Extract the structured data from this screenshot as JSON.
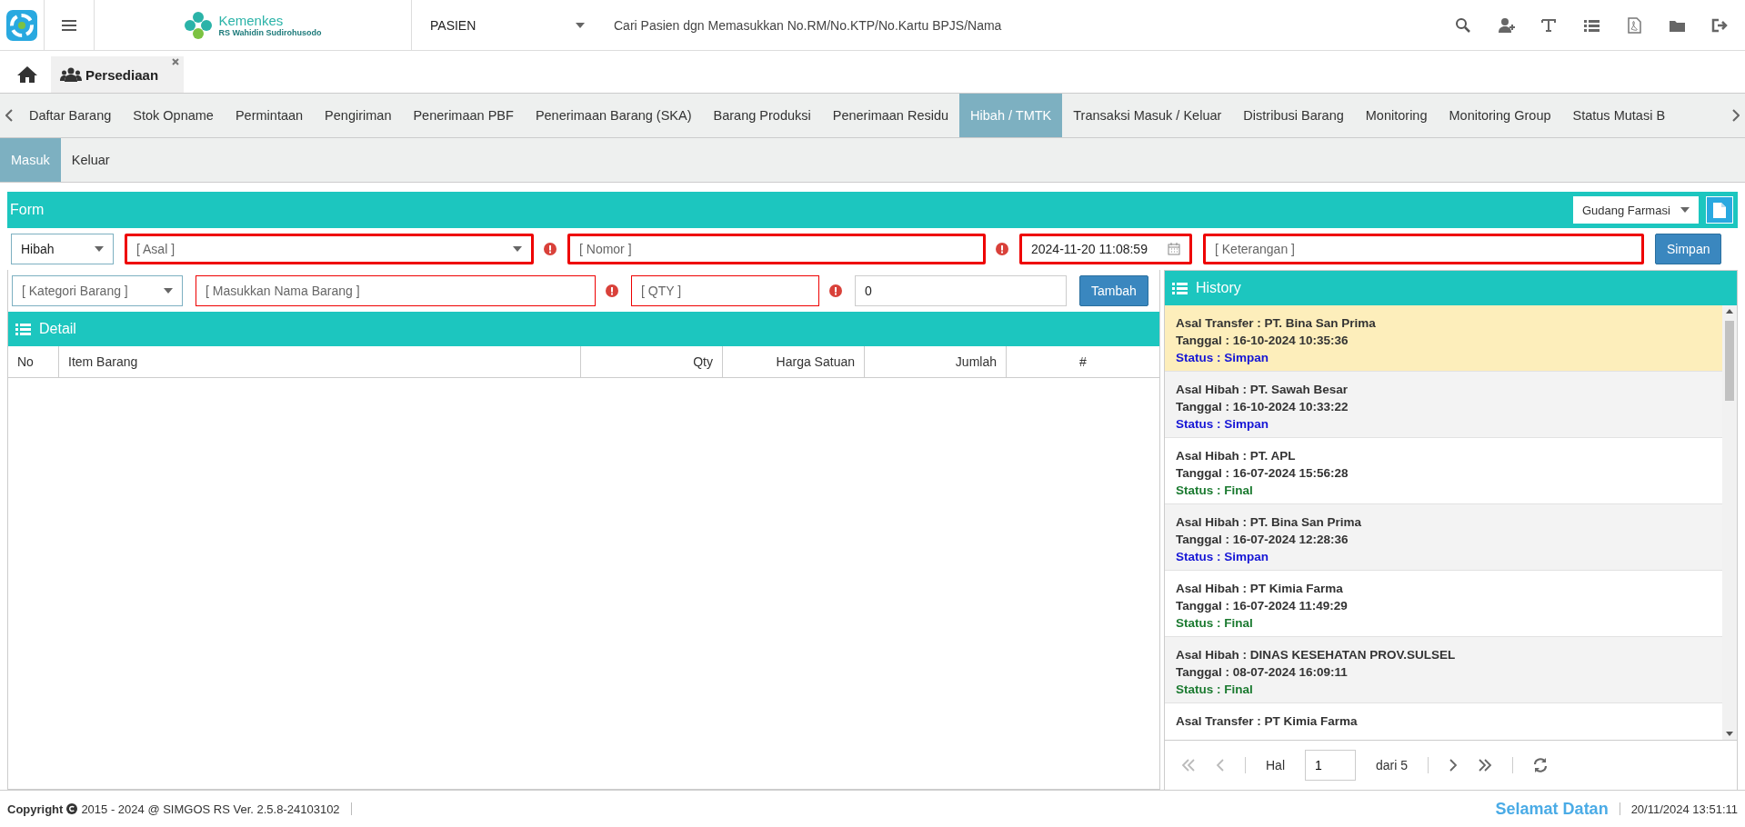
{
  "header": {
    "logo_title": "Kemenkes",
    "logo_subtitle": "RS Wahidin Sudirohusodo",
    "patient_select": "PASIEN",
    "search": {
      "placeholder": "Cari Pasien dgn Memasukkan No.RM/No.KTP/No.Kartu BPJS/Nama"
    }
  },
  "page_tabs": [
    {
      "label": "Persediaan",
      "selected": true
    }
  ],
  "nav_tabs": [
    {
      "label": "Daftar Barang",
      "selected": false
    },
    {
      "label": "Stok Opname",
      "selected": false
    },
    {
      "label": "Permintaan",
      "selected": false
    },
    {
      "label": "Pengiriman",
      "selected": false
    },
    {
      "label": "Penerimaan PBF",
      "selected": false
    },
    {
      "label": "Penerimaan Barang (SKA)",
      "selected": false
    },
    {
      "label": "Barang Produksi",
      "selected": false
    },
    {
      "label": "Penerimaan Residu",
      "selected": false
    },
    {
      "label": "Hibah / TMTK",
      "selected": true
    },
    {
      "label": "Transaksi Masuk / Keluar",
      "selected": false
    },
    {
      "label": "Distribusi Barang",
      "selected": false
    },
    {
      "label": "Monitoring",
      "selected": false
    },
    {
      "label": "Monitoring Group",
      "selected": false
    },
    {
      "label": "Status Mutasi B",
      "selected": false
    }
  ],
  "sub_tabs": [
    {
      "label": "Masuk",
      "selected": true
    },
    {
      "label": "Keluar",
      "selected": false
    }
  ],
  "form": {
    "title": "Form",
    "warehouse_select": "Gudang Farmasi",
    "fields": [
      {
        "kind": "select",
        "value": "Hibah",
        "invalid": false,
        "required": false
      },
      {
        "kind": "select",
        "placeholder": "[ Asal ]",
        "invalid": true,
        "required": true
      },
      {
        "kind": "input",
        "placeholder": "[ Nomor ]",
        "invalid": true,
        "required": true
      },
      {
        "kind": "date",
        "value": "2024-11-20 11:08:59",
        "invalid": true,
        "required": false
      },
      {
        "kind": "input",
        "placeholder": "[ Keterangan ]",
        "invalid": true,
        "required": false
      }
    ],
    "save_button": "Simpan"
  },
  "item_entry": {
    "fields": [
      {
        "kind": "select",
        "placeholder": "[ Kategori Barang ]",
        "invalid": false,
        "required": false
      },
      {
        "kind": "input",
        "placeholder": "[ Masukkan Nama Barang ]",
        "invalid": true,
        "required": true
      },
      {
        "kind": "input",
        "placeholder": "[ QTY ]",
        "invalid": true,
        "required": true
      },
      {
        "kind": "input",
        "value": "0",
        "invalid": false,
        "required": false
      }
    ],
    "add_button": "Tambah"
  },
  "detail": {
    "title": "Detail",
    "columns": [
      "No",
      "Item Barang",
      "Qty",
      "Harga Satuan",
      "Jumlah",
      "#"
    ]
  },
  "history": {
    "title": "History",
    "items": [
      {
        "origin": "Asal Transfer : PT. Bina San Prima",
        "date": "Tanggal : 16-10-2024 10:35:36",
        "status": "Status : Simpan",
        "kind": "saved",
        "selected": true
      },
      {
        "origin": "Asal Hibah : PT. Sawah Besar",
        "date": "Tanggal : 16-10-2024 10:33:22",
        "status": "Status : Simpan",
        "kind": "saved",
        "selected": false
      },
      {
        "origin": "Asal Hibah : PT. APL",
        "date": "Tanggal : 16-07-2024 15:56:28",
        "status": "Status : Final",
        "kind": "final",
        "selected": false
      },
      {
        "origin": "Asal Hibah : PT. Bina San Prima",
        "date": "Tanggal : 16-07-2024 12:28:36",
        "status": "Status : Simpan",
        "kind": "saved",
        "selected": false
      },
      {
        "origin": "Asal Hibah : PT Kimia Farma",
        "date": "Tanggal : 16-07-2024 11:49:29",
        "status": "Status : Final",
        "kind": "final",
        "selected": false
      },
      {
        "origin": "Asal Hibah : DINAS KESEHATAN PROV.SULSEL",
        "date": "Tanggal : 08-07-2024 16:09:11",
        "status": "Status : Final",
        "kind": "final",
        "selected": false
      },
      {
        "origin": "Asal Transfer : PT Kimia Farma",
        "selected": false
      }
    ],
    "pager": {
      "page_label": "Hal",
      "page": "1",
      "total": "dari 5"
    }
  },
  "footer": {
    "copyright": "Copyright",
    "version": "2015 - 2024 @ SIMGOS RS Ver. 2.5.8-24103102",
    "welcome": "Selamat Datan",
    "datetime": "20/11/2024 13:51:11"
  }
}
